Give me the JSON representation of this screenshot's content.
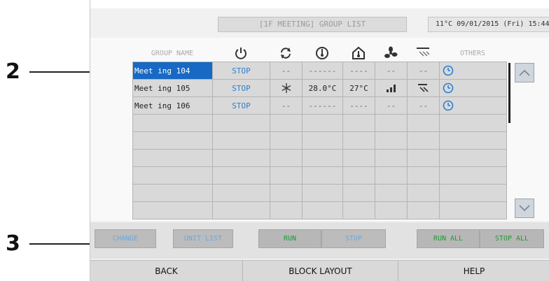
{
  "callouts": {
    "row_callout": "2",
    "button_callout": "3"
  },
  "header": {
    "title": "[1F MEETING] GROUP LIST",
    "status": "11°C  09/01/2015 (Fri) 15:44"
  },
  "columns": {
    "group_name": "GROUP NAME",
    "others": "OTHERS",
    "icons": [
      "power-icon",
      "mode-icon",
      "temperature-icon",
      "room-temperature-icon",
      "fan-speed-icon",
      "air-direction-icon"
    ]
  },
  "rows": [
    {
      "name": "Meet ing 104",
      "status": "STOP",
      "mode": "--",
      "setpoint": "------",
      "room": "----",
      "fan": "--",
      "direction": "--",
      "timer": "clock-icon",
      "selected": true
    },
    {
      "name": "Meet ing 105",
      "status": "STOP",
      "mode": "snowflake-icon",
      "setpoint": "28.0°C",
      "room": "27°C",
      "fan": "fan-level-icon",
      "direction": "louver-icon",
      "timer": "clock-icon",
      "selected": false
    },
    {
      "name": "Meet ing 106",
      "status": "STOP",
      "mode": "--",
      "setpoint": "------",
      "room": "----",
      "fan": "--",
      "direction": "--",
      "timer": "clock-icon",
      "selected": false
    }
  ],
  "buttons": {
    "change": "CHANGE",
    "unit_list": "UNIT LIST",
    "run": "RUN",
    "stop": "STOP",
    "run_all": "RUN ALL",
    "stop_all": "STOP ALL"
  },
  "footer": {
    "back": "BACK",
    "block_layout": "BLOCK LAYOUT",
    "help": "HELP"
  },
  "colors": {
    "selected_row": "#1769c3",
    "stop_text": "#2c7fd1",
    "run_text": "#1f9a35"
  }
}
